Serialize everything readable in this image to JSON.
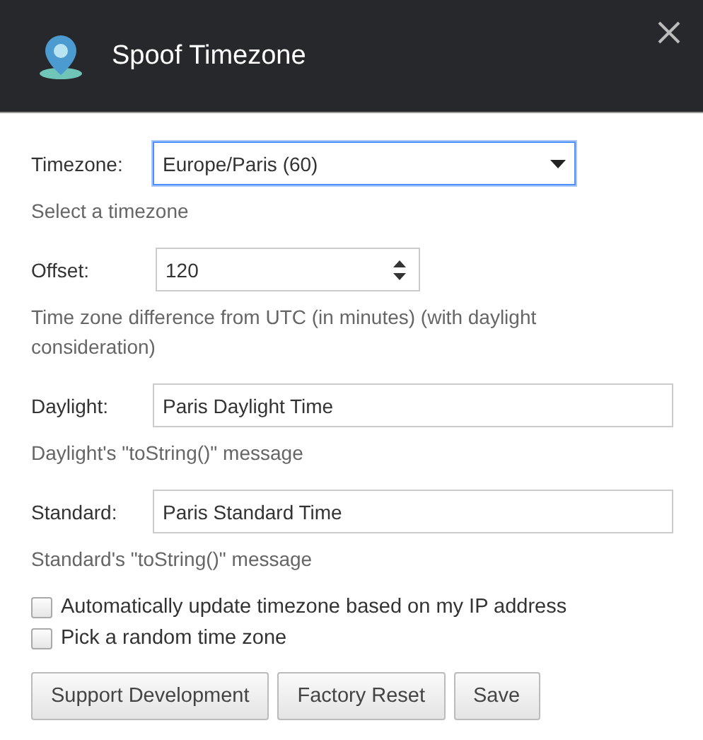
{
  "window": {
    "title": "Spoof Timezone"
  },
  "fields": [
    {
      "kind": "select",
      "label": "Timezone:",
      "value": "Europe/Paris (60)",
      "hint": "Select a timezone"
    },
    {
      "kind": "number",
      "label": "Offset:",
      "value": "120",
      "hint": "Time zone difference from UTC (in minutes) (with daylight consideration)"
    },
    {
      "kind": "text",
      "label": "Daylight:",
      "value": "Paris Daylight Time",
      "hint": "Daylight's \"toString()\" message"
    },
    {
      "kind": "text",
      "label": "Standard:",
      "value": "Paris Standard Time",
      "hint": "Standard's \"toString()\" message"
    }
  ],
  "options": [
    {
      "label": "Automatically update timezone based on my IP address",
      "checked": false
    },
    {
      "label": "Pick a random time zone",
      "checked": false
    }
  ],
  "buttons": [
    "Support Development",
    "Factory Reset",
    "Save"
  ]
}
